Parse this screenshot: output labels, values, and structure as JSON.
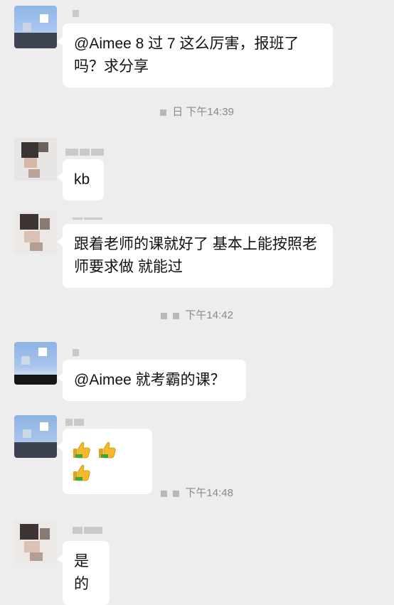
{
  "messages": [
    {
      "text": "@Aimee 8 过 7 这么厉害，报班了吗？求分享"
    },
    {
      "text": "kb"
    },
    {
      "text": "跟着老师的课就好了 基本上能按照老师要求做 就能过"
    },
    {
      "text": "@Aimee  就考霸的课？"
    },
    {
      "emoji": [
        "thumbs-up",
        "thumbs-up",
        "thumbs-up"
      ]
    },
    {
      "text": "是的"
    }
  ],
  "timestamps": [
    {
      "prefix": "日",
      "text": "下午14:39"
    },
    {
      "prefix": "",
      "text": "下午14:42"
    },
    {
      "prefix": "",
      "text": "下午14:48"
    }
  ],
  "colors": {
    "background": "#ededed",
    "bubble": "#ffffff",
    "timestamp": "#8a8a8a"
  }
}
